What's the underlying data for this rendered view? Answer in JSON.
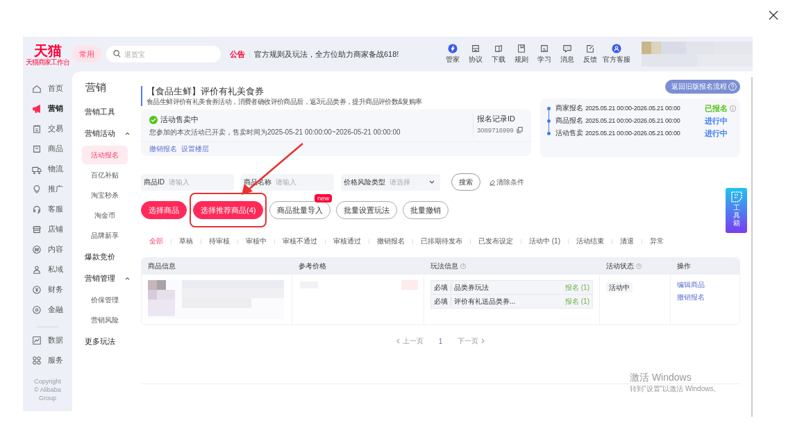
{
  "topbar": {
    "logo": "天猫",
    "logo_subtitle": "天猫商家工作台",
    "quick_button": "常用",
    "search": {
      "placeholder": "退货宝"
    },
    "notice": {
      "tag": "公告",
      "text": "官方规则及玩法，全方位助力商家备战618!"
    },
    "tools": [
      {
        "label": "管家",
        "kind": "butler"
      },
      {
        "label": "协议",
        "kind": "protocol"
      },
      {
        "label": "下载",
        "kind": "download"
      },
      {
        "label": "规则",
        "kind": "rules"
      },
      {
        "label": "学习",
        "kind": "study"
      },
      {
        "label": "消息",
        "kind": "message"
      },
      {
        "label": "反馈",
        "kind": "feedback"
      },
      {
        "label": "官方客服",
        "kind": "service"
      }
    ]
  },
  "nav": {
    "items": [
      {
        "label": "首页",
        "kind": "home",
        "selected": false
      },
      {
        "label": "营销",
        "kind": "megaphone",
        "selected": true
      },
      {
        "label": "交易",
        "kind": "trade",
        "selected": false
      },
      {
        "label": "商品",
        "kind": "goods",
        "selected": false
      },
      {
        "label": "物流",
        "kind": "truck",
        "selected": false
      },
      {
        "label": "推广",
        "kind": "bulb",
        "selected": false
      },
      {
        "label": "客服",
        "kind": "headset",
        "selected": false
      },
      {
        "label": "店铺",
        "kind": "shop",
        "selected": false
      },
      {
        "label": "内容",
        "kind": "content",
        "selected": false
      },
      {
        "label": "私域",
        "kind": "people",
        "selected": false
      },
      {
        "label": "财务",
        "kind": "finance",
        "selected": false
      },
      {
        "label": "金融",
        "kind": "banking",
        "selected": false
      }
    ],
    "bottom_items": [
      {
        "label": "数据",
        "kind": "data",
        "selected": false
      },
      {
        "label": "服务",
        "kind": "grid",
        "selected": false
      }
    ],
    "copyright": [
      "Copyright",
      "© Alibaba",
      "Group"
    ]
  },
  "submenu": {
    "title": "营销",
    "items": [
      {
        "label": "营销工具",
        "kind": "link"
      },
      {
        "label": "营销活动",
        "kind": "group",
        "expanded": true,
        "children": [
          {
            "label": "活动报名",
            "selected": true
          },
          {
            "label": "百亿补贴",
            "selected": false
          },
          {
            "label": "淘宝秒杀",
            "selected": false
          },
          {
            "label": "淘金币",
            "selected": false
          },
          {
            "label": "品牌新享",
            "selected": false
          }
        ]
      },
      {
        "label": "爆款竞价",
        "kind": "link"
      },
      {
        "label": "营销管理",
        "kind": "group",
        "expanded": true,
        "children": [
          {
            "label": "价保管理",
            "selected": false
          },
          {
            "label": "营销风险",
            "selected": false
          }
        ]
      },
      {
        "label": "更多玩法",
        "kind": "link"
      }
    ]
  },
  "activity": {
    "title": "【食品生鲜】评价有礼美食券",
    "description": "食品生鲜评价有礼美食券活动，消费者确收评价商品后，返3元品类券，提升商品评价数&复购率",
    "status": {
      "label": "活动售卖中",
      "detail": "您参加的本次活动已开卖，售卖时间为2025-05-21 00:00:00~2026-05-21 00:00:00"
    },
    "links": [
      "撤销报名",
      "设置楼层"
    ],
    "record": {
      "label": "报名记录ID",
      "value": "3089716999"
    },
    "legacy_button": "返回旧版报名流程",
    "timeline": [
      {
        "stage": "商家报名",
        "period": "2025.05.21 00:00-2026.05.21 00:00",
        "status": "已报名",
        "color": "#52c41a",
        "info": true
      },
      {
        "stage": "商品报名",
        "period": "2025.05.21 00:00-2026.05.21 00:00",
        "status": "进行中",
        "color": "#3f7cf6",
        "info": false
      },
      {
        "stage": "活动售卖",
        "period": "2025.05.21 00:00-2026.05.21 00:00",
        "status": "进行中",
        "color": "#3f7cf6",
        "info": false
      }
    ]
  },
  "filters": [
    {
      "label": "商品ID",
      "placeholder": "请输入",
      "kind": "input"
    },
    {
      "label": "商品名称",
      "placeholder": "请输入",
      "kind": "input"
    },
    {
      "label": "价格风险类型",
      "placeholder": "请选择",
      "kind": "select"
    }
  ],
  "search_button": "搜索",
  "clear_button": "清除条件",
  "actions": [
    {
      "label": "选择商品",
      "primary": true,
      "highlighted": false
    },
    {
      "label": "选择推荐商品(4)",
      "primary": true,
      "highlighted": true
    },
    {
      "label": "商品批量导入",
      "primary": false,
      "highlighted": false,
      "badge": "new"
    },
    {
      "label": "批量设置玩法",
      "primary": false,
      "highlighted": false
    },
    {
      "label": "批量撤销",
      "primary": false,
      "highlighted": false
    }
  ],
  "status_tabs": [
    {
      "label": "全部",
      "selected": true
    },
    {
      "label": "草稿",
      "selected": false
    },
    {
      "label": "待审核",
      "selected": false
    },
    {
      "label": "审核中",
      "selected": false
    },
    {
      "label": "审核不通过",
      "selected": false
    },
    {
      "label": "审核通过",
      "selected": false
    },
    {
      "label": "撤销报名",
      "selected": false
    },
    {
      "label": "已排期待发布",
      "selected": false
    },
    {
      "label": "已发布设定",
      "selected": false
    },
    {
      "label": "活动中 (1)",
      "selected": false
    },
    {
      "label": "活动结束",
      "selected": false
    },
    {
      "label": "清退",
      "selected": false
    },
    {
      "label": "异常",
      "selected": false
    }
  ],
  "table": {
    "columns": [
      {
        "label": "商品信息",
        "help": false
      },
      {
        "label": "参考价格",
        "help": false
      },
      {
        "label": "玩法信息",
        "help": true
      },
      {
        "label": "活动状态",
        "help": true
      },
      {
        "label": "操作",
        "help": false
      }
    ],
    "rows": [
      {
        "plays": [
          {
            "tag": "必填",
            "name": "品类券玩法",
            "action": "报名 (1)"
          },
          {
            "tag": "必填",
            "name": "评价有礼送品类券...",
            "action": "报名 (1)"
          }
        ],
        "status": "活动中",
        "operations": [
          "编辑商品",
          "撤销报名"
        ]
      }
    ]
  },
  "pagination": {
    "prev": "上一页",
    "pages": [
      {
        "label": "1",
        "selected": true
      }
    ],
    "next": "下一页"
  },
  "toolbox": {
    "label": "工具箱"
  },
  "os_notice": {
    "title": "激活 Windows",
    "text": "转到\"设置\"以激活 Windows。"
  }
}
